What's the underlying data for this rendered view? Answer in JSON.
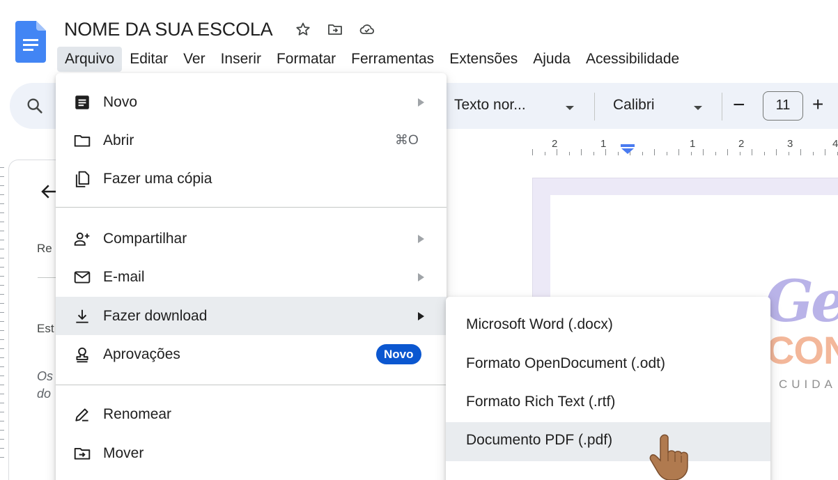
{
  "header": {
    "title": "NOME DA SUA ESCOLA",
    "icons": [
      "star-icon",
      "move-to-folder-icon",
      "cloud-saved-icon"
    ]
  },
  "menubar": {
    "items": [
      "Arquivo",
      "Editar",
      "Ver",
      "Inserir",
      "Formatar",
      "Ferramentas",
      "Extensões",
      "Ajuda",
      "Acessibilidade"
    ],
    "active": "Arquivo"
  },
  "toolbar": {
    "style": "Texto nor...",
    "font": "Calibri",
    "minus": "−",
    "size": "11",
    "plus": "+"
  },
  "ruler": {
    "labels": [
      "2",
      "1",
      "1",
      "2",
      "3",
      "4"
    ]
  },
  "left_panel": {
    "text1": "Re",
    "text2": "Est",
    "text3": "Os",
    "text4": "do"
  },
  "document": {
    "logo_line1": "Ger",
    "logo_line2": "CON",
    "logo_line3": "CUIDA"
  },
  "file_menu": {
    "items": [
      {
        "label": "Novo",
        "icon": "document-icon",
        "arrow": true
      },
      {
        "label": "Abrir",
        "icon": "folder-icon",
        "shortcut": "⌘O"
      },
      {
        "label": "Fazer uma cópia",
        "icon": "copy-icon"
      },
      {
        "label": "Compartilhar",
        "icon": "person-add-icon",
        "arrow": true
      },
      {
        "label": "E-mail",
        "icon": "mail-icon",
        "arrow": true
      },
      {
        "label": "Fazer download",
        "icon": "download-icon",
        "arrow": true
      },
      {
        "label": "Aprovações",
        "icon": "approval-icon",
        "badge": "Novo"
      },
      {
        "label": "Renomear",
        "icon": "rename-icon"
      },
      {
        "label": "Mover",
        "icon": "move-folder-icon"
      }
    ]
  },
  "download_submenu": {
    "items": [
      "Microsoft Word (.docx)",
      "Formato OpenDocument (.odt)",
      "Formato Rich Text (.rtf)",
      "Documento PDF (.pdf)"
    ]
  },
  "colors": {
    "accent": "#0b57d0",
    "menu_hover": "#e9ecef",
    "toolbar_bg": "#eef2f9"
  }
}
